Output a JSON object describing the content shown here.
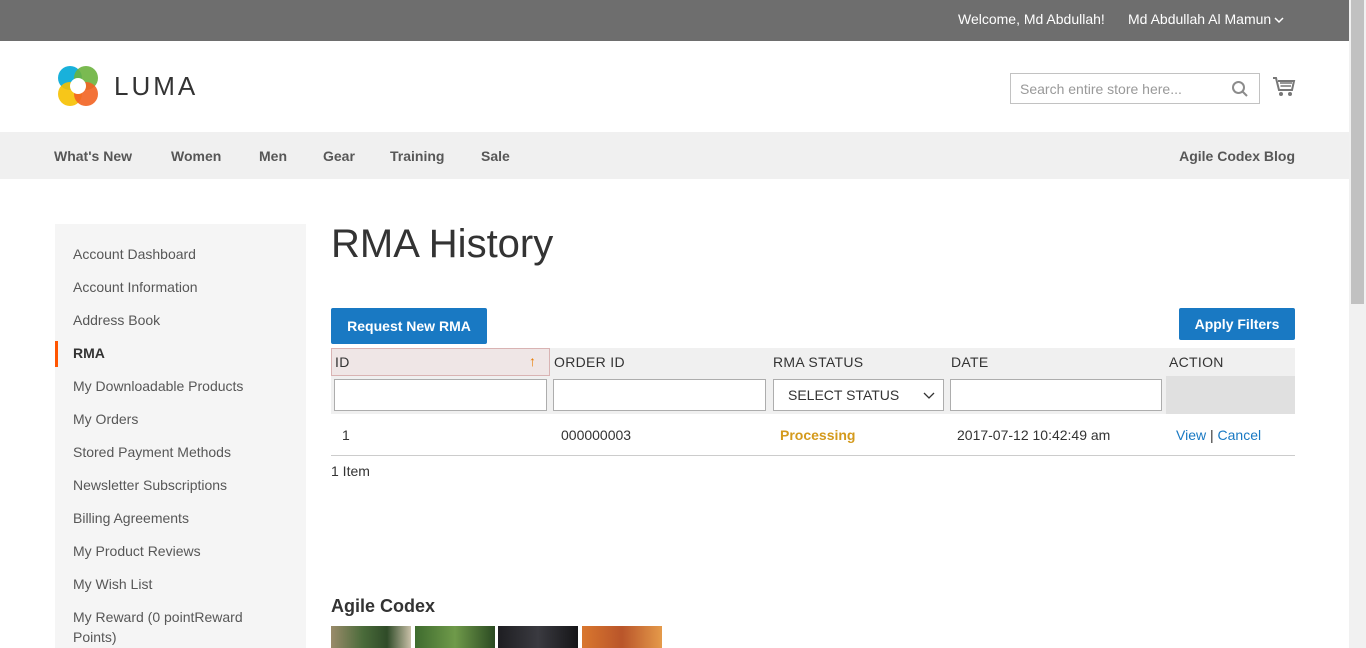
{
  "topbar": {
    "welcome": "Welcome, Md Abdullah!",
    "account_name": "Md Abdullah Al Mamun"
  },
  "header": {
    "logo_text": "LUMA",
    "search_placeholder": "Search entire store here...",
    "search_value": ""
  },
  "nav": {
    "items": [
      "What's New",
      "Women",
      "Men",
      "Gear",
      "Training",
      "Sale"
    ],
    "blog": "Agile Codex Blog"
  },
  "sidebar": {
    "items": [
      "Account Dashboard",
      "Account Information",
      "Address Book",
      "RMA",
      "My Downloadable Products",
      "My Orders",
      "Stored Payment Methods",
      "Newsletter Subscriptions",
      "Billing Agreements",
      "My Product Reviews",
      "My Wish List",
      "My Reward (0 pointReward Points)"
    ],
    "active": "RMA"
  },
  "main": {
    "title": "RMA History",
    "request_button": "Request New RMA",
    "apply_button": "Apply Filters",
    "columns": [
      "ID",
      "ORDER ID",
      "RMA STATUS",
      "DATE",
      "ACTION"
    ],
    "sort_indicator": "↑",
    "filters": {
      "id": "",
      "order_id": "",
      "status_selected": "SELECT STATUS",
      "date": ""
    },
    "rows": [
      {
        "id": "1",
        "order_id": "000000003",
        "status": "Processing",
        "date": "2017-07-12 10:42:49 am",
        "view": "View",
        "separator": "|",
        "cancel": "Cancel"
      }
    ],
    "count": "1 Item"
  },
  "footer_block": {
    "title": "Agile Codex"
  },
  "colors": {
    "topbar": "#6e6e6e",
    "primary": "#1979c3",
    "status_processing": "#d49a1c",
    "active_marker": "#ff5501"
  }
}
